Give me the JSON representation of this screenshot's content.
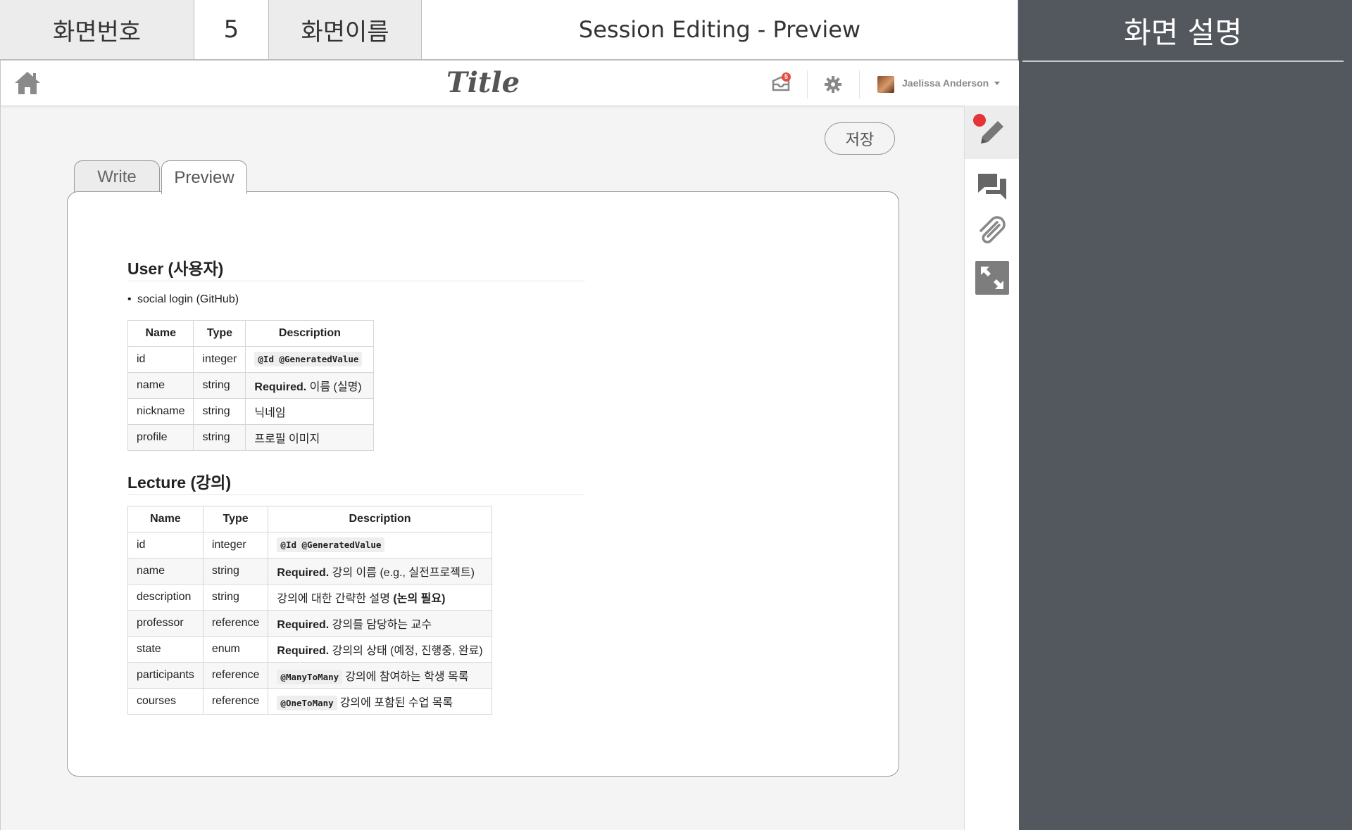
{
  "meta": {
    "screen_no_label": "화면번호",
    "screen_no": "5",
    "screen_name_label": "화면이름",
    "screen_name": "Session Editing - Preview",
    "description_title": "화면 설명"
  },
  "navbar": {
    "title": "Title",
    "notification_count": "5",
    "user_name": "Jaelissa Anderson"
  },
  "editor": {
    "save_label": "저장",
    "tabs": [
      {
        "label": "Write",
        "active": false
      },
      {
        "label": "Preview",
        "active": true
      }
    ]
  },
  "preview": {
    "sections": [
      {
        "heading": "User (사용자)",
        "bullets": [
          "social login (GitHub)"
        ],
        "columns": [
          "Name",
          "Type",
          "Description"
        ],
        "rows": [
          {
            "name": "id",
            "type": "integer",
            "code": "@Id @GeneratedValue",
            "strong": "",
            "text": ""
          },
          {
            "name": "name",
            "type": "string",
            "code": "",
            "strong": "Required.",
            "text": "이름 (실명)"
          },
          {
            "name": "nickname",
            "type": "string",
            "code": "",
            "strong": "",
            "text": "닉네임"
          },
          {
            "name": "profile",
            "type": "string",
            "code": "",
            "strong": "",
            "text": "프로필 이미지"
          }
        ]
      },
      {
        "heading": "Lecture (강의)",
        "bullets": [],
        "columns": [
          "Name",
          "Type",
          "Description"
        ],
        "rows": [
          {
            "name": "id",
            "type": "integer",
            "code": "@Id @GeneratedValue",
            "strong": "",
            "text": ""
          },
          {
            "name": "name",
            "type": "string",
            "code": "",
            "strong": "Required.",
            "text": "강의 이름 (e.g., 실전프로젝트)"
          },
          {
            "name": "description",
            "type": "string",
            "code": "",
            "strong": "",
            "text": "강의에 대한 간략한 설명",
            "strong_after": "(논의 필요)"
          },
          {
            "name": "professor",
            "type": "reference",
            "code": "",
            "strong": "Required.",
            "text": "강의를 담당하는 교수"
          },
          {
            "name": "state",
            "type": "enum",
            "code": "",
            "strong": "Required.",
            "text": "강의의 상태 (예정, 진행중, 완료)"
          },
          {
            "name": "participants",
            "type": "reference",
            "code": "@ManyToMany",
            "strong": "",
            "text": "강의에 참여하는 학생 목록"
          },
          {
            "name": "courses",
            "type": "reference",
            "code": "@OneToMany",
            "strong": "",
            "text": "강의에 포함된 수업 목록"
          }
        ]
      }
    ]
  },
  "toolbar_icons": [
    "pencil-icon",
    "question-answer-icon",
    "paperclip-icon",
    "expand-icon"
  ],
  "colors": {
    "record_dot": "#e5333a",
    "description_panel": "#53575e",
    "badge": "#e74c3c"
  }
}
